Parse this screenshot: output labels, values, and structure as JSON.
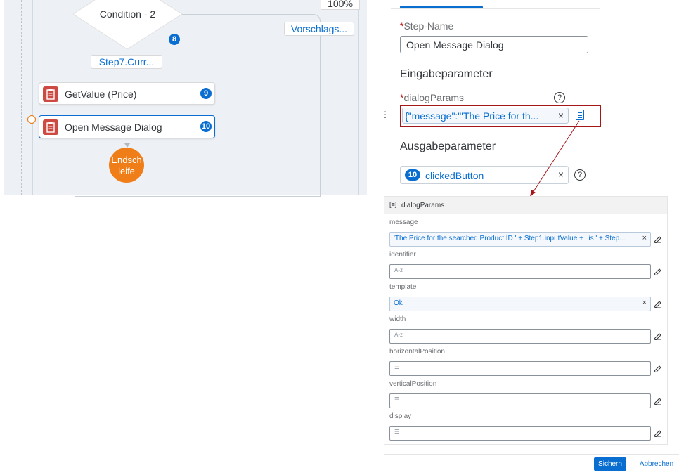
{
  "canvas": {
    "zoom": "100%",
    "condition_label": "Condition - 2",
    "condition_badge": "8",
    "suggestion_link": "Vorschlags...",
    "step_link": "Step7.Curr...",
    "nodes": [
      {
        "label": "GetValue (Price)",
        "badge": "9"
      },
      {
        "label": "Open Message Dialog",
        "badge": "10"
      }
    ],
    "end_node_line1": "Endsch",
    "end_node_line2": "leife"
  },
  "panel": {
    "step_name_label": "Step-Name",
    "step_name_value": "Open Message Dialog",
    "input_params_heading": "Eingabeparameter",
    "dialog_params_label": "dialogParams",
    "dialog_params_value": "{\"message\":\"'The Price for th...",
    "output_params_heading": "Ausgabeparameter",
    "output_badge": "10",
    "output_value": "clickedButton"
  },
  "popup": {
    "title": "dialogParams",
    "fields": [
      {
        "label": "message",
        "value": "'The Price for the searched Product ID ' + Step1.inputValue + ' is ' + Step...",
        "placeholder": ""
      },
      {
        "label": "identifier",
        "value": "",
        "placeholder": "A-z"
      },
      {
        "label": "template",
        "value": "Ok",
        "placeholder": ""
      },
      {
        "label": "width",
        "value": "",
        "placeholder": "A-z"
      },
      {
        "label": "horizontalPosition",
        "value": "",
        "placeholder": "☰"
      },
      {
        "label": "verticalPosition",
        "value": "",
        "placeholder": "☰"
      },
      {
        "label": "display",
        "value": "",
        "placeholder": "☰"
      }
    ]
  },
  "footer": {
    "save_label": "Sichern",
    "cancel_label": "Abbrechen"
  },
  "colors": {
    "accent": "#0a6ed1",
    "highlight_border": "#a4161a",
    "end_node": "#f07e18",
    "step_icon": "#cc4a41"
  }
}
